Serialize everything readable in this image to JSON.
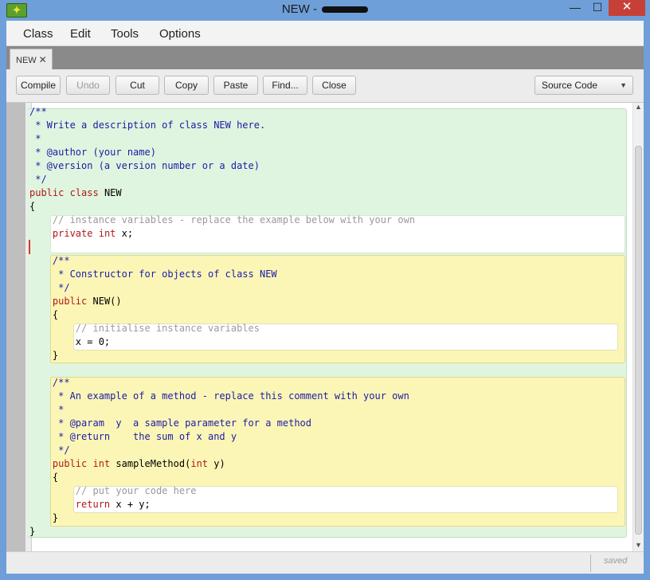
{
  "window": {
    "title": "NEW - ",
    "min_icon": "minimize-icon",
    "max_icon": "maximize-icon",
    "close_icon": "close-icon",
    "min_glyph": "—",
    "max_glyph": "☐",
    "close_glyph": "✕"
  },
  "menu": {
    "items": [
      "Class",
      "Edit",
      "Tools",
      "Options"
    ]
  },
  "tabs": [
    {
      "label": "NEW",
      "close_glyph": "✕"
    }
  ],
  "toolbar": {
    "buttons": [
      {
        "label": "Compile",
        "enabled": true
      },
      {
        "label": "Undo",
        "enabled": false
      },
      {
        "label": "Cut",
        "enabled": true
      },
      {
        "label": "Copy",
        "enabled": true
      },
      {
        "label": "Paste",
        "enabled": true
      },
      {
        "label": "Find...",
        "enabled": true
      },
      {
        "label": "Close",
        "enabled": true
      }
    ],
    "view_select": "Source Code"
  },
  "code_lines": [
    "/**",
    " * Write a description of class NEW here.",
    " *",
    " * @author (your name)",
    " * @version (a version number or a date)",
    " */",
    "public class NEW",
    "{",
    "    // instance variables - replace the example below with your own",
    "    private int x;",
    "",
    "    /**",
    "     * Constructor for objects of class NEW",
    "     */",
    "    public NEW()",
    "    {",
    "        // initialise instance variables",
    "        x = 0;",
    "    }",
    "",
    "    /**",
    "     * An example of a method - replace this comment with your own",
    "     *",
    "     * @param  y  a sample parameter for a method",
    "     * @return    the sum of x and y",
    "     */",
    "    public int sampleMethod(int y)",
    "    {",
    "        // put your code here",
    "        return x + y;",
    "    }",
    "}"
  ],
  "status": {
    "saved": "saved"
  },
  "colors": {
    "class_scope": "#dff5df",
    "method_scope": "#fbf6b6",
    "keyword": "#b01818",
    "doc_comment": "#1c1ca6",
    "line_comment": "#9a9a9a"
  }
}
